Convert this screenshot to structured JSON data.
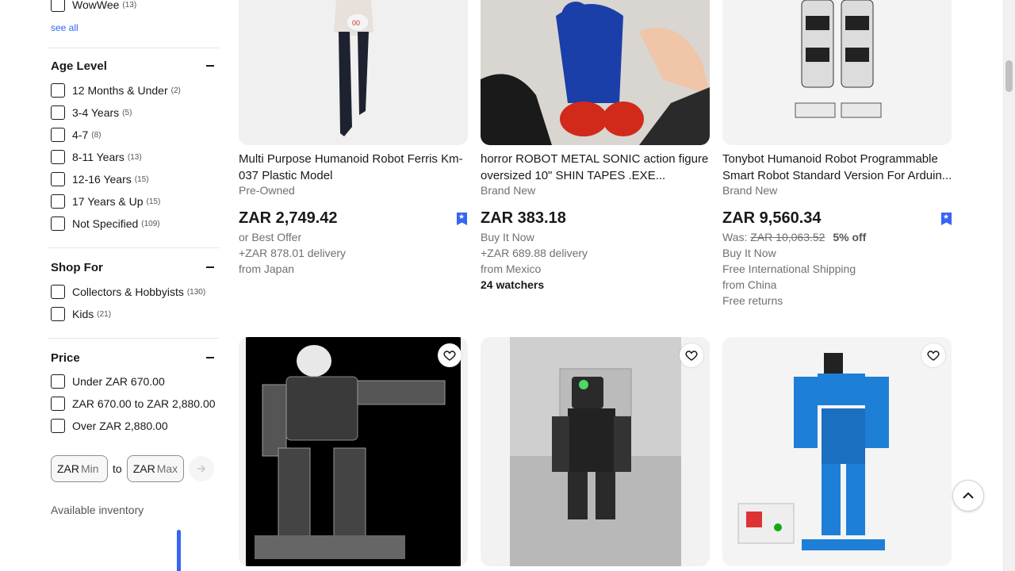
{
  "filters": {
    "brand_partial": {
      "label": "WowWee",
      "count": "(13)"
    },
    "see_all": "see all",
    "age_level": {
      "title": "Age Level",
      "items": [
        {
          "label": "12 Months & Under",
          "count": "(2)"
        },
        {
          "label": "3-4 Years",
          "count": "(5)"
        },
        {
          "label": "4-7",
          "count": "(8)"
        },
        {
          "label": "8-11 Years",
          "count": "(13)"
        },
        {
          "label": "12-16 Years",
          "count": "(15)"
        },
        {
          "label": "17 Years & Up",
          "count": "(15)"
        },
        {
          "label": "Not Specified",
          "count": "(109)"
        }
      ]
    },
    "shop_for": {
      "title": "Shop For",
      "items": [
        {
          "label": "Collectors & Hobbyists",
          "count": "(130)"
        },
        {
          "label": "Kids",
          "count": "(21)"
        }
      ]
    },
    "price": {
      "title": "Price",
      "items": [
        {
          "label": "Under ZAR 670.00"
        },
        {
          "label": "ZAR 670.00 to ZAR 2,880.00"
        },
        {
          "label": "Over ZAR 2,880.00"
        }
      ],
      "currency": "ZAR",
      "min_placeholder": "Min",
      "max_placeholder": "Max",
      "to": "to"
    },
    "available_inventory": "Available inventory"
  },
  "listings": [
    {
      "title": "Multi Purpose Humanoid Robot Ferris Km-037 Plastic Model",
      "condition": "Pre-Owned",
      "price": "ZAR 2,749.42",
      "line1": "or Best Offer",
      "line2": "+ZAR 878.01 delivery",
      "line3": "from Japan",
      "watched": true
    },
    {
      "title": "horror ROBOT METAL SONIC action figure oversized 10\" SHIN TAPES .EXE...",
      "condition": "Brand New",
      "price": "ZAR 383.18",
      "line1": "Buy It Now",
      "line2": "+ZAR 689.88 delivery",
      "line3": "from Mexico",
      "watchers": "24 watchers"
    },
    {
      "title": "Tonybot Humanoid Robot Programmable Smart Robot Standard Version For Arduin...",
      "condition": "Brand New",
      "price": "ZAR 9,560.34",
      "was_label": "Was:",
      "was_price": "ZAR 10,063.52",
      "discount": "5% off",
      "line1": "Buy It Now",
      "line2": "Free International Shipping",
      "line3": "from China",
      "line4": "Free returns",
      "watched": true
    }
  ],
  "icons": {
    "heart": "heart-icon",
    "watched": "watched-flag-icon",
    "back_to_top": "chevron-up-icon",
    "submit_price": "arrow-right-icon"
  },
  "colors": {
    "accent": "#3665f3"
  }
}
